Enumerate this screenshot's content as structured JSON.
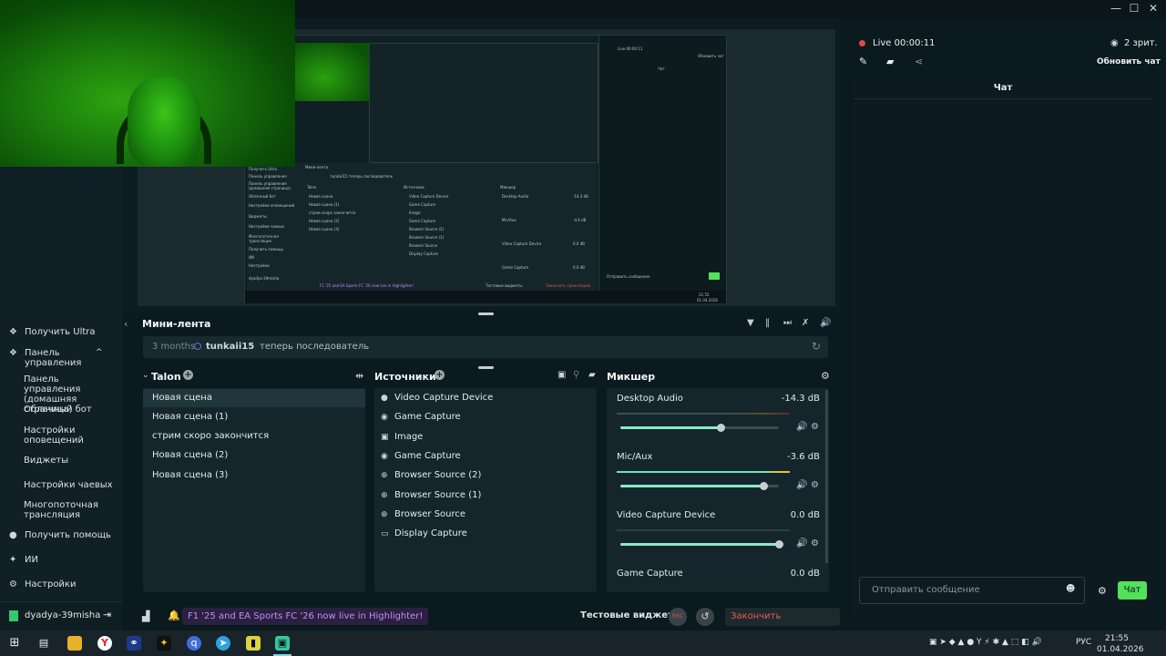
{
  "window": {
    "minimize": "—",
    "maximize": "☐",
    "close": "✕",
    "collapse": "›"
  },
  "sidebar": {
    "get_ultra": "Получить Ultra",
    "dashboard": "Панель управления",
    "dashboard_home": "Панель управления (домашняя страница)",
    "cloudbot": "Облачный бот",
    "alert_settings": "Настройки оповещений",
    "widgets": "Виджеты",
    "tip_settings": "Настройки чаевых",
    "multistream": "Многопоточная трансляция",
    "get_help": "Получить помощь",
    "ai": "ИИ",
    "settings": "Настройки",
    "username": "dyadya-39misha"
  },
  "minifeed": {
    "title": "Мини-лента",
    "time": "3 months",
    "user": "tunkaii15",
    "text": "теперь последователь"
  },
  "scenes": {
    "title": "Talon",
    "items": [
      "Новая сцена",
      "Новая сцена (1)",
      "стрим скоро закончится",
      "Новая сцена (2)",
      "Новая сцена (3)"
    ]
  },
  "sources": {
    "title": "Источники",
    "items": [
      {
        "label": "Video Capture Device",
        "icon": "camera-icon"
      },
      {
        "label": "Game Capture",
        "icon": "gamepad-icon"
      },
      {
        "label": "Image",
        "icon": "image-icon"
      },
      {
        "label": "Game Capture",
        "icon": "gamepad-icon"
      },
      {
        "label": "Browser Source (2)",
        "icon": "globe-icon"
      },
      {
        "label": "Browser Source (1)",
        "icon": "globe-icon"
      },
      {
        "label": "Browser Source",
        "icon": "globe-icon"
      },
      {
        "label": "Display Capture",
        "icon": "monitor-icon"
      }
    ]
  },
  "mixer": {
    "title": "Микшер",
    "channels": [
      {
        "name": "Desktop Audio",
        "db": "-14.3 dB",
        "level": 0.63
      },
      {
        "name": "Mic/Aux",
        "db": "-3.6 dB",
        "level": 0.9
      },
      {
        "name": "Video Capture Device",
        "db": "0.0 dB",
        "level": 1.0
      },
      {
        "name": "Game Capture",
        "db": "0.0 dB",
        "level": 1.0
      }
    ]
  },
  "bottombar": {
    "news": "F1 '25 and EA Sports FC '26 now live in Highlighter!",
    "test_widgets": "Тестовые виджеты",
    "rec": "REC",
    "end_stream": "Закончить трансляцию"
  },
  "chat": {
    "live": "Live",
    "timer": "00:00:11",
    "viewers": "2 зрит.",
    "refresh": "Обновить чат",
    "title": "Чат",
    "placeholder": "Отправить сообщение",
    "send": "Чат"
  },
  "nested_preview": {
    "minifeed": "Мини-лента",
    "user": "tunkaii15 теперь последователь",
    "scenes": "Talon",
    "sources": "Источники",
    "mixer": "Микшер",
    "scene_items": [
      "Новая сцена",
      "Новая сцена (1)",
      "стрим скоро закончится",
      "Новая сцена (2)",
      "Новая сцена (3)"
    ],
    "source_items": [
      "Video Capture Device",
      "Game Capture",
      "Image",
      "Game Capture",
      "Browser Source (2)",
      "Browser Source (1)",
      "Browser Source",
      "Display Capture"
    ],
    "mixer_items": [
      "Desktop Audio",
      "Mic/Aux",
      "Video Capture Device",
      "Game Capture"
    ],
    "mixer_db": [
      "-14.3 dB",
      "-4.4 dB",
      "0.0 dB",
      "0.0 dB"
    ],
    "sidebar_items": [
      "Получить Ultra",
      "Панель управления",
      "Панель управления (домашняя страница)",
      "Облачный бот",
      "Настройки оповещений",
      "Виджеты",
      "Настройки чаевых",
      "Многопоточная трансляция",
      "Получить помощь",
      "ИИ",
      "Настройки"
    ],
    "username": "dyadya-39misha",
    "news": "F1 '25 and EA Sports FC '26 now live in Highlighter!",
    "test_widgets": "Тестовые виджеты",
    "end_stream": "Закончить трансляцию",
    "chat_live": "Live 00:00:11",
    "chat_refresh": "Обновить чат",
    "chat_title": "Чат",
    "chat_placeholder": "Отправить сообщение",
    "time": "21:55",
    "date": "01.04.2026"
  },
  "taskbar": {
    "lang": "РУС",
    "time": "21:55",
    "date": "01.04.2026"
  }
}
